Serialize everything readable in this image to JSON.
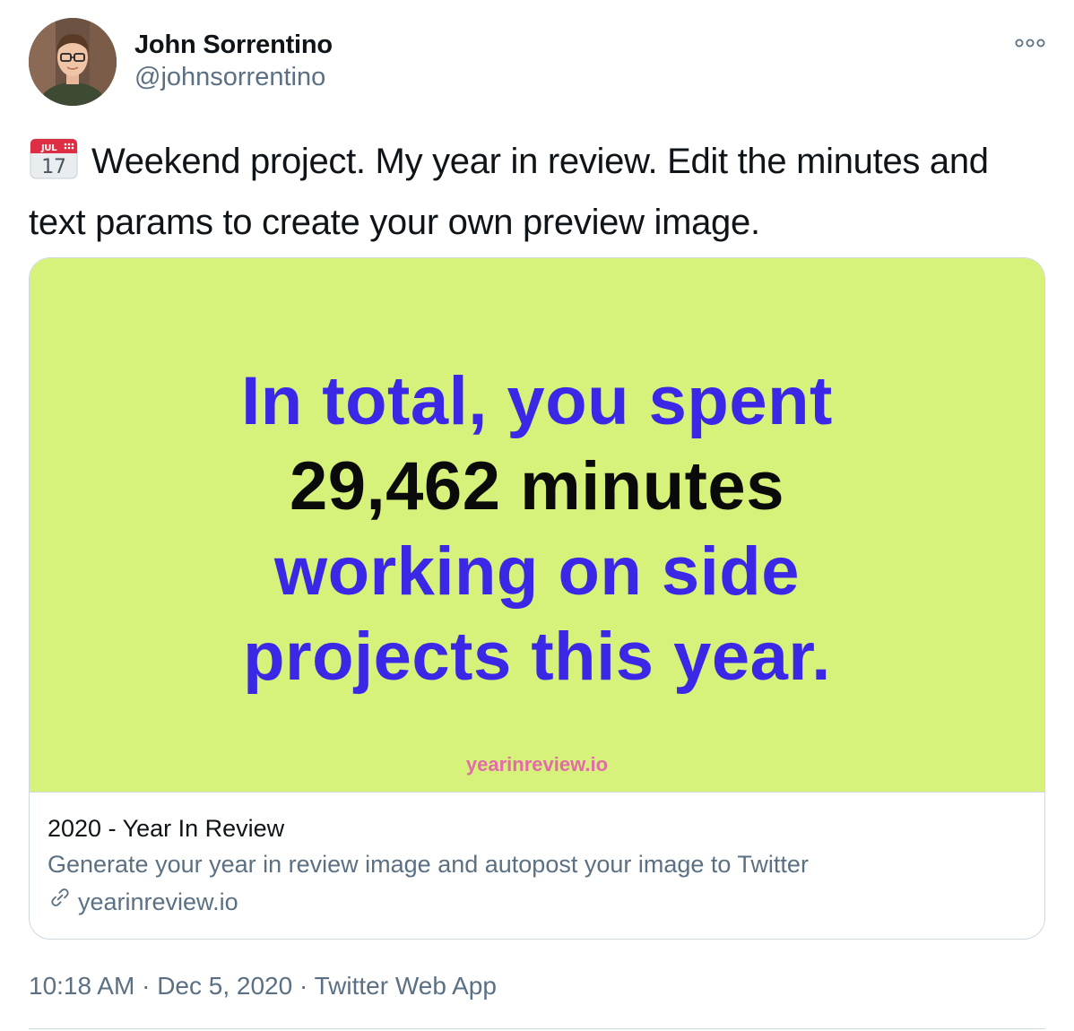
{
  "author": {
    "name": "John Sorrentino",
    "handle": "@johnsorrentino"
  },
  "tweet": {
    "text": "Weekend project. My year in review. Edit the minutes and text params to create your own preview image.",
    "calendar_emoji": {
      "month": "JUL",
      "day": "17"
    }
  },
  "card": {
    "image": {
      "line1": "In total, you spent",
      "line2": "29,462 minutes",
      "line3": "working on side",
      "line4": "projects this year.",
      "site": "yearinreview.io",
      "background": "#d6f27a",
      "accent_text_color": "#3a28e6",
      "site_color": "#e26ba8"
    },
    "title": "2020 - Year In Review",
    "description": "Generate your year in review image and autopost your image to Twitter",
    "domain": "yearinreview.io"
  },
  "meta": {
    "time": "10:18 AM",
    "date": "Dec 5, 2020",
    "source": "Twitter Web App",
    "separator": "·"
  }
}
